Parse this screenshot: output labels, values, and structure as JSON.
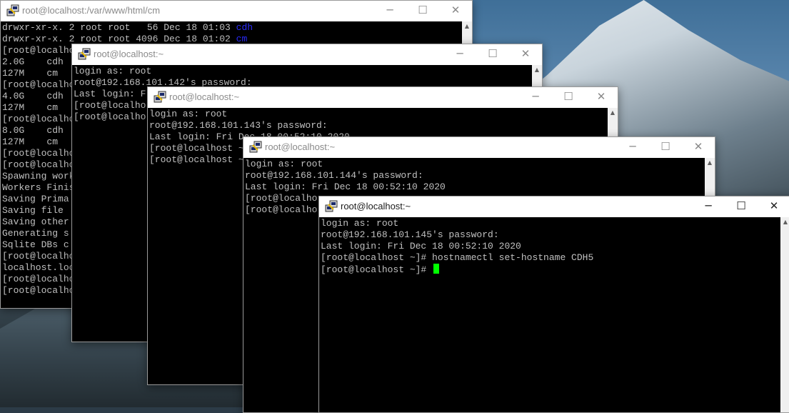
{
  "windows": {
    "w1": {
      "title": "root@localhost:/var/www/html/cm",
      "lines": [
        "drwxr-xr-x. 2 root root   56 Dec 18 01:03 ",
        "drwxr-xr-x. 2 root root 4096 Dec 18 01:02 ",
        "[root@localho",
        "2.0G    cdh",
        "127M    cm",
        "[root@localho",
        "4.0G    cdh",
        "127M    cm",
        "[root@localho",
        "8.0G    cdh",
        "127M    cm",
        "[root@localho",
        "[root@localho",
        "Spawning work",
        "Workers Finis",
        "Saving Prima",
        "Saving file ",
        "Saving other",
        "Generating s",
        "Sqlite DBs c",
        "[root@localho",
        "localhost.loc",
        "[root@localho",
        "[root@localho"
      ],
      "dir_names": [
        "cdh",
        "cm"
      ]
    },
    "w2": {
      "title": "root@localhost:~",
      "lines": [
        "login as: root",
        "root@192.168.101.142's password:",
        "Last login: F",
        "[root@localho",
        "[root@localho"
      ]
    },
    "w3": {
      "title": "root@localhost:~",
      "lines": [
        "login as: root",
        "root@192.168.101.143's password:",
        "Last login: Fri Dec 18 00:52:10 2020",
        "[root@localhost ~",
        "[root@localhost ~"
      ]
    },
    "w4": {
      "title": "root@localhost:~",
      "lines": [
        "login as: root",
        "root@192.168.101.144's password:",
        "Last login: Fri Dec 18 00:52:10 2020",
        "[root@localho",
        "[root@localho"
      ]
    },
    "w5": {
      "title": "root@localhost:~",
      "lines": [
        "login as: root",
        "root@192.168.101.145's password:",
        "Last login: Fri Dec 18 00:52:10 2020",
        "[root@localhost ~]# hostnamectl set-hostname CDH5",
        "[root@localhost ~]# "
      ]
    }
  },
  "controls": {
    "minimize": "─",
    "maximize": "☐",
    "close": "✕"
  },
  "colors": {
    "terminal_bg": "#000000",
    "terminal_fg": "#c0c0c0",
    "cursor": "#00ff00",
    "dir_color": "#2b2bff"
  },
  "icons": {
    "app": "putty-icon",
    "scroll_up": "up-arrow-icon"
  }
}
